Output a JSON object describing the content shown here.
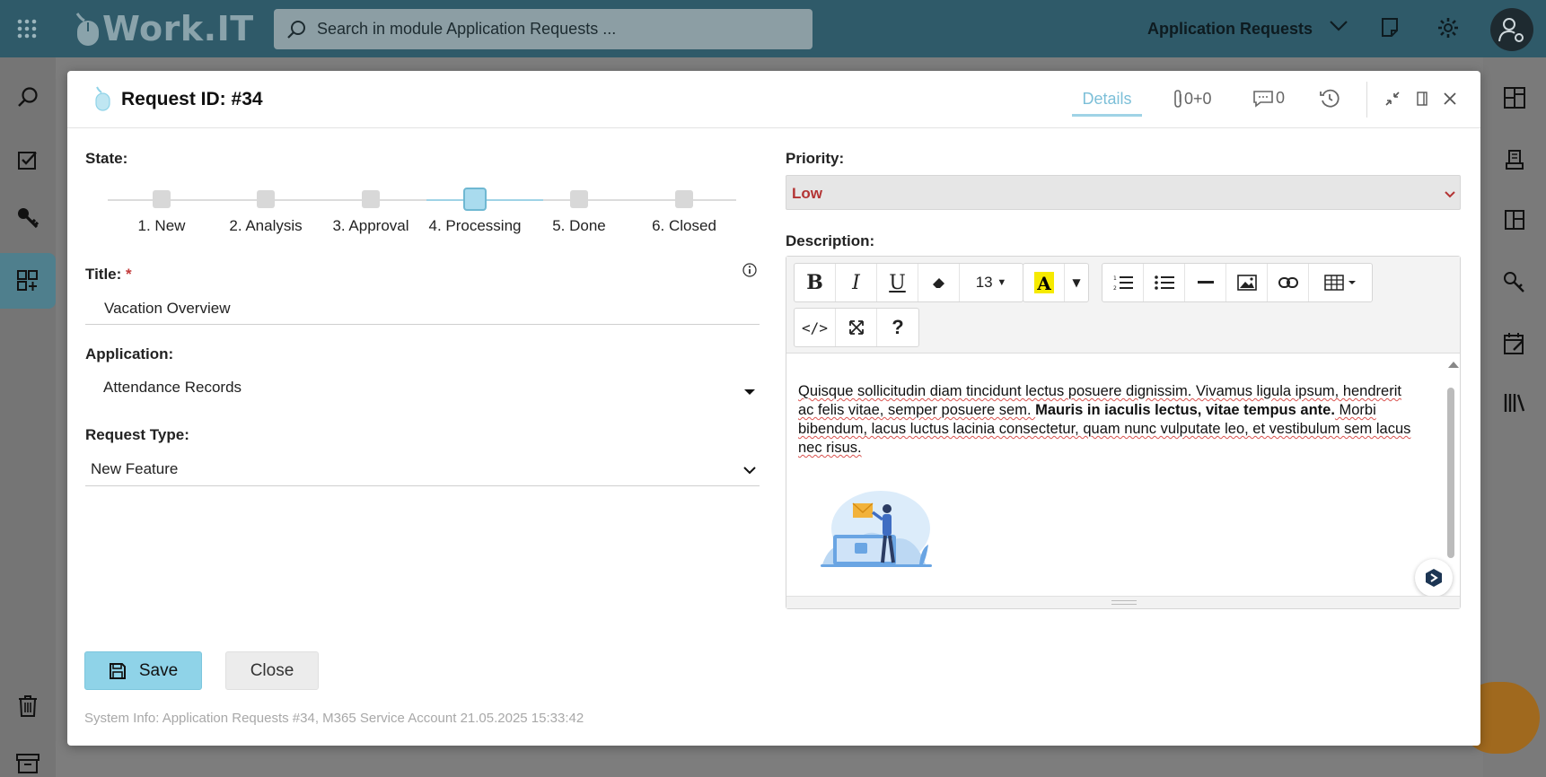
{
  "app": {
    "logo": "Work.IT",
    "module": "Application Requests"
  },
  "search": {
    "placeholder": "Search in module Application Requests ..."
  },
  "dialog": {
    "title": "Request ID: #34",
    "tabs": {
      "details": "Details",
      "attachments": "0+0",
      "comments": "0"
    }
  },
  "state": {
    "label": "State:",
    "steps": [
      "1. New",
      "2. Analysis",
      "3. Approval",
      "4. Processing",
      "5. Done",
      "6. Closed"
    ],
    "active_index": 3
  },
  "title_field": {
    "label": "Title:",
    "required_mark": "*",
    "value": "Vacation Overview"
  },
  "application": {
    "label": "Application:",
    "value": "Attendance Records"
  },
  "request_type": {
    "label": "Request Type:",
    "value": "New Feature"
  },
  "priority": {
    "label": "Priority:",
    "value": "Low"
  },
  "description": {
    "label": "Description:",
    "font_size": "13",
    "text_part1": "Quisque sollicitudin diam tincidunt lectus posuere dignissim. Vivamus ligula ipsum, hendrerit ac felis vitae, semper posuere sem. ",
    "text_bold": "Mauris in iaculis lectus, vitae tempus ante.",
    "text_part2": " Morbi bibendum, lacus luctus lacinia consectetur, quam nunc vulputate leo, et vestibulum sem lacus nec risus."
  },
  "buttons": {
    "save": "Save",
    "close": "Close"
  },
  "system_info": "System Info: Application Requests #34, M365 Service Account 21.05.2025 15:33:42",
  "colors": {
    "topbar": "#2f5a69",
    "accent": "#8fd3e8",
    "priority_text": "#b33434"
  }
}
